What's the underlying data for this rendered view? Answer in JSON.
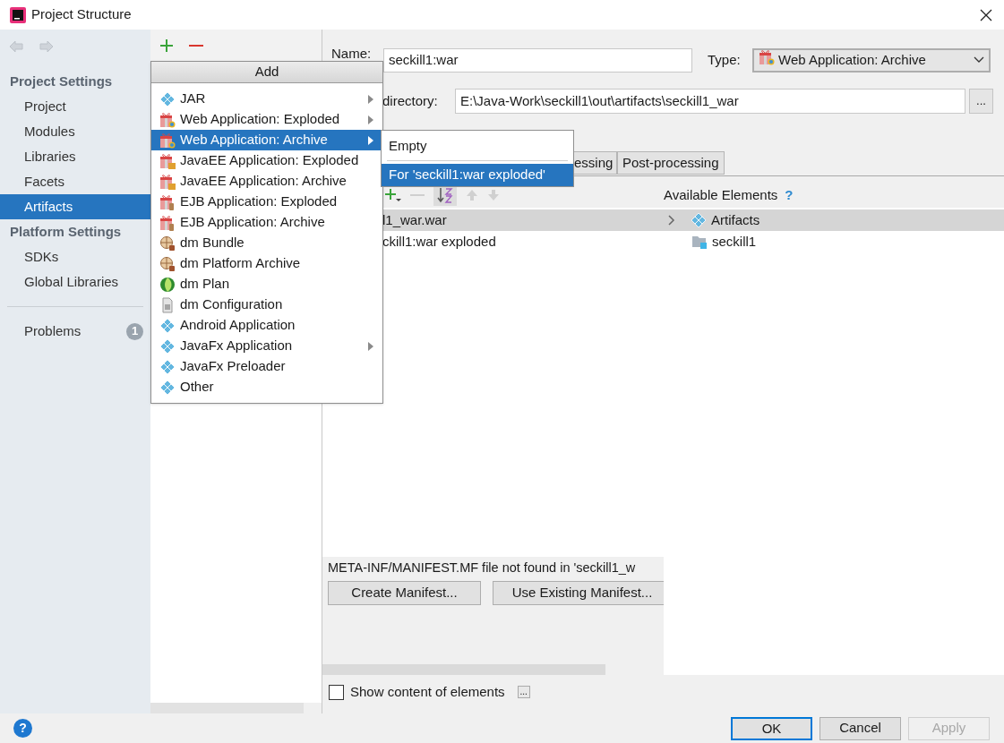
{
  "window": {
    "title": "Project Structure"
  },
  "sidebar": {
    "sections": [
      {
        "title": "Project Settings",
        "items": [
          {
            "label": "Project",
            "selected": false
          },
          {
            "label": "Modules",
            "selected": false
          },
          {
            "label": "Libraries",
            "selected": false
          },
          {
            "label": "Facets",
            "selected": false
          },
          {
            "label": "Artifacts",
            "selected": true
          }
        ]
      },
      {
        "title": "Platform Settings",
        "items": [
          {
            "label": "SDKs",
            "selected": false
          },
          {
            "label": "Global Libraries",
            "selected": false
          }
        ]
      }
    ],
    "problems": {
      "label": "Problems",
      "count": "1"
    }
  },
  "name_field": {
    "label": "Name:",
    "value": "seckill1:war"
  },
  "type_select": {
    "label": "Type:",
    "value": "Web Application: Archive"
  },
  "output_directory": {
    "label": "directory:",
    "value": "E:\\Java-Work\\seckill1\\out\\artifacts\\seckill1_war",
    "browse": "..."
  },
  "tabs": [
    {
      "label": "essing",
      "selected": false
    },
    {
      "label": "Post-processing",
      "selected": false
    }
  ],
  "layout_tree": {
    "rows": [
      {
        "label": "l1_war.war",
        "selected": true
      },
      {
        "label": "ckill1:war exploded",
        "selected": false
      }
    ]
  },
  "available_elements": {
    "title": "Available Elements",
    "help": "?",
    "rows": [
      {
        "label": "Artifacts",
        "kind": "group",
        "selected": true
      },
      {
        "label": "seckill1",
        "kind": "module",
        "selected": false
      }
    ]
  },
  "manifest": {
    "message": "META-INF/MANIFEST.MF file not found in 'seckill1_w",
    "buttons": [
      "Create Manifest...",
      "Use Existing Manifest..."
    ]
  },
  "show_content": {
    "label": "Show content of elements",
    "checked": false,
    "more": "..."
  },
  "add_menu": {
    "title": "Add",
    "items": [
      {
        "label": "JAR",
        "kind": "diamond",
        "submenu": true,
        "selected": false
      },
      {
        "label": "Web Application: Exploded",
        "kind": "web",
        "submenu": true,
        "selected": false
      },
      {
        "label": "Web Application: Archive",
        "kind": "web",
        "submenu": true,
        "selected": true
      },
      {
        "label": "JavaEE Application: Exploded",
        "kind": "javaee",
        "submenu": false,
        "selected": false
      },
      {
        "label": "JavaEE Application: Archive",
        "kind": "javaee",
        "submenu": false,
        "selected": false
      },
      {
        "label": "EJB Application: Exploded",
        "kind": "ejb",
        "submenu": false,
        "selected": false
      },
      {
        "label": "EJB Application: Archive",
        "kind": "ejb",
        "submenu": false,
        "selected": false
      },
      {
        "label": "dm Bundle",
        "kind": "bundle",
        "submenu": false,
        "selected": false
      },
      {
        "label": "dm Platform Archive",
        "kind": "bundle",
        "submenu": false,
        "selected": false
      },
      {
        "label": "dm Plan",
        "kind": "plan",
        "submenu": false,
        "selected": false
      },
      {
        "label": "dm Configuration",
        "kind": "config",
        "submenu": false,
        "selected": false
      },
      {
        "label": "Android Application",
        "kind": "diamond",
        "submenu": false,
        "selected": false
      },
      {
        "label": "JavaFx Application",
        "kind": "diamond",
        "submenu": true,
        "selected": false
      },
      {
        "label": "JavaFx Preloader",
        "kind": "diamond",
        "submenu": false,
        "selected": false
      },
      {
        "label": "Other",
        "kind": "diamond",
        "submenu": false,
        "selected": false
      }
    ]
  },
  "submenu": {
    "items": [
      {
        "label": "Empty",
        "selected": false
      },
      {
        "label": "For 'seckill1:war exploded'",
        "selected": true
      }
    ]
  },
  "footer": {
    "help": "?",
    "buttons": [
      {
        "label": "OK",
        "default": true,
        "disabled": false
      },
      {
        "label": "Cancel",
        "default": false,
        "disabled": false
      },
      {
        "label": "Apply",
        "default": false,
        "disabled": true
      }
    ]
  }
}
